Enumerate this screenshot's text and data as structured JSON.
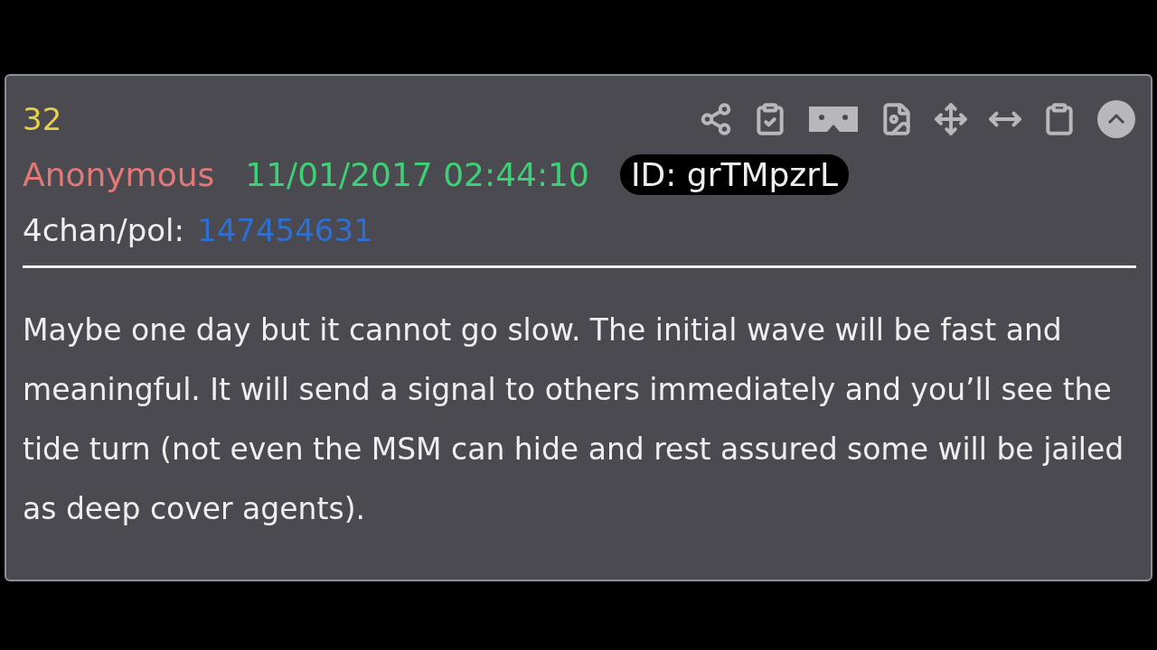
{
  "post": {
    "number": "32",
    "author": "Anonymous",
    "timestamp": "11/01/2017 02:44:10",
    "id_badge": "ID: grTMpzrL",
    "source_label": "4chan/pol:",
    "source_link": "147454631",
    "body": "Maybe one day but it cannot go slow. The initial wave will be fast and meaningful. It will send a signal to others immediately and you’ll see the tide turn (not even the MSM can hide and rest assured some will be jailed as deep cover agents)."
  }
}
